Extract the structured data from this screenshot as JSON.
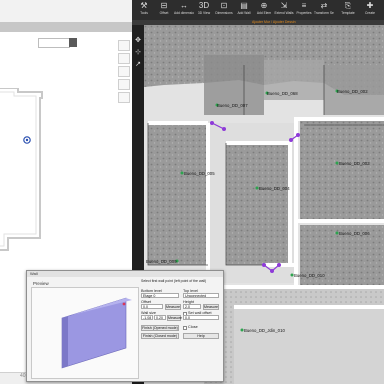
{
  "left_app": {
    "footer_text": "40",
    "search_placeholder": ""
  },
  "ribbon": {
    "buttons": [
      {
        "label": "Tools",
        "icon": "tools-icon"
      },
      {
        "label": "Offset",
        "icon": "offset-icon"
      },
      {
        "label": "Add dimension",
        "icon": "dimension-icon"
      },
      {
        "label": "3D View",
        "icon": "3d-view-icon"
      },
      {
        "label": "Dimensions",
        "icon": "dimensions-icon"
      },
      {
        "label": "Add Wall",
        "icon": "wall-icon"
      },
      {
        "label": "Add Elem",
        "icon": "add-element-icon"
      },
      {
        "label": "Extend Walls",
        "icon": "extend-walls-icon"
      },
      {
        "label": "Properties",
        "icon": "properties-icon"
      },
      {
        "label": "Transform Selection",
        "icon": "transform-icon"
      },
      {
        "label": "Template",
        "icon": "template-icon"
      },
      {
        "label": "Create",
        "icon": "create-icon"
      }
    ],
    "ribbon_icons": [
      "⚒",
      "⊟",
      "↔",
      "3D",
      "⊡",
      "▤",
      "⊕",
      "⇲",
      "≡",
      "⇄",
      "⎘",
      "✚"
    ],
    "subtitle": "Ajouter Mur / Ajouter Dessin"
  },
  "rooms": [
    "Bueno_DD_007",
    "Bueno_DD_068",
    "Bueno_DD_002",
    "Bueno_DD_005",
    "Bueno_DD_004",
    "Bueno_DD_003",
    "Bueno_DD_006",
    "Bueno_DD_009",
    "Bueno_DD_010",
    "Bueno_DD_Jdin_010"
  ],
  "dialog": {
    "title": "Wall",
    "preview_label": "Preview",
    "instruction": "Select first wall point (left point of the wall)",
    "bottom_level_label": "Bottom level",
    "bottom_level_value": "Etage 0",
    "top_level_label": "Top level",
    "top_level_value": "Unconnected",
    "offset_label": "Offset",
    "offset_value": "0.0",
    "height_label": "Height",
    "height_value": "2.0",
    "measure_label": "Measure",
    "wall_size_label": "Wall size",
    "wall_size_value": "0.20",
    "set_wall_offset_label": "Set wall offset",
    "offset_extra_value": "0.0",
    "third_value": "-1.08",
    "close_label": "Close",
    "help_label": "Help",
    "finish_opened_label": "Finish (Opened mode)",
    "finish_closed_label": "Finish (Closed mode)",
    "accent_color": "#8a86d8"
  }
}
